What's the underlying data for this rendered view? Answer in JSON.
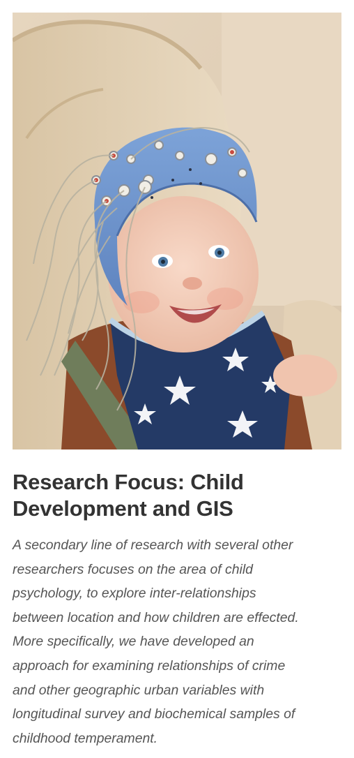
{
  "photo": {
    "alt": "Smiling baby wearing a blue EEG electrode cap and a star-patterned bib"
  },
  "title_lines": [
    "Research Focus: Child",
    "Development and GIS"
  ],
  "body_lines": [
    "A secondary line of research with several other",
    "researchers focuses on the area of child",
    "psychology, to explore inter-relationships",
    "between location and how children are effected.",
    "More specifically, we have developed an",
    "approach for examining relationships of crime",
    "and other geographic urban variables with",
    "longitudinal survey and biochemical samples of",
    "childhood temperament."
  ]
}
